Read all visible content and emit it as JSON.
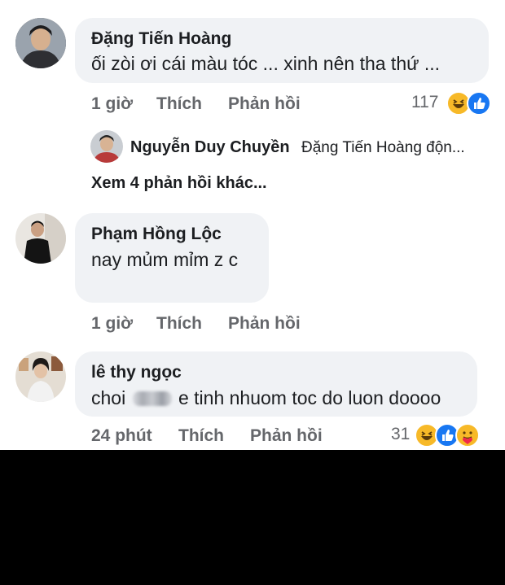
{
  "comments": [
    {
      "author": "Đặng Tiến Hoàng",
      "text": "ối zòi ơi cái màu tóc ... xinh nên tha thứ ...",
      "time": "1 giờ",
      "like_label": "Thích",
      "reply_label": "Phản hồi",
      "reaction_count": "117",
      "reactions": [
        "haha-icon",
        "like-icon"
      ]
    },
    {
      "author": "Phạm Hồng Lộc",
      "text": "nay mủm mỉm z c",
      "time": "1 giờ",
      "like_label": "Thích",
      "reply_label": "Phản hồi"
    },
    {
      "author": "lê thy ngọc",
      "text_before": "choi",
      "text_after": "e tinh nhuom toc do luon doooo",
      "time": "24 phút",
      "like_label": "Thích",
      "reply_label": "Phản hồi",
      "reaction_count": "31",
      "reactions": [
        "haha-icon",
        "like-icon",
        "care-icon"
      ]
    }
  ],
  "reply_preview": {
    "author": "Nguyễn Duy Chuyền",
    "snippet": "Đặng Tiến Hoàng  độn..."
  },
  "more_replies": "Xem 4 phản hồi khác...",
  "colors": {
    "bubble": "#f0f2f5",
    "like_blue": "#1877f2",
    "haha_yellow": "#f7b928",
    "secondary_text": "#65676b"
  }
}
